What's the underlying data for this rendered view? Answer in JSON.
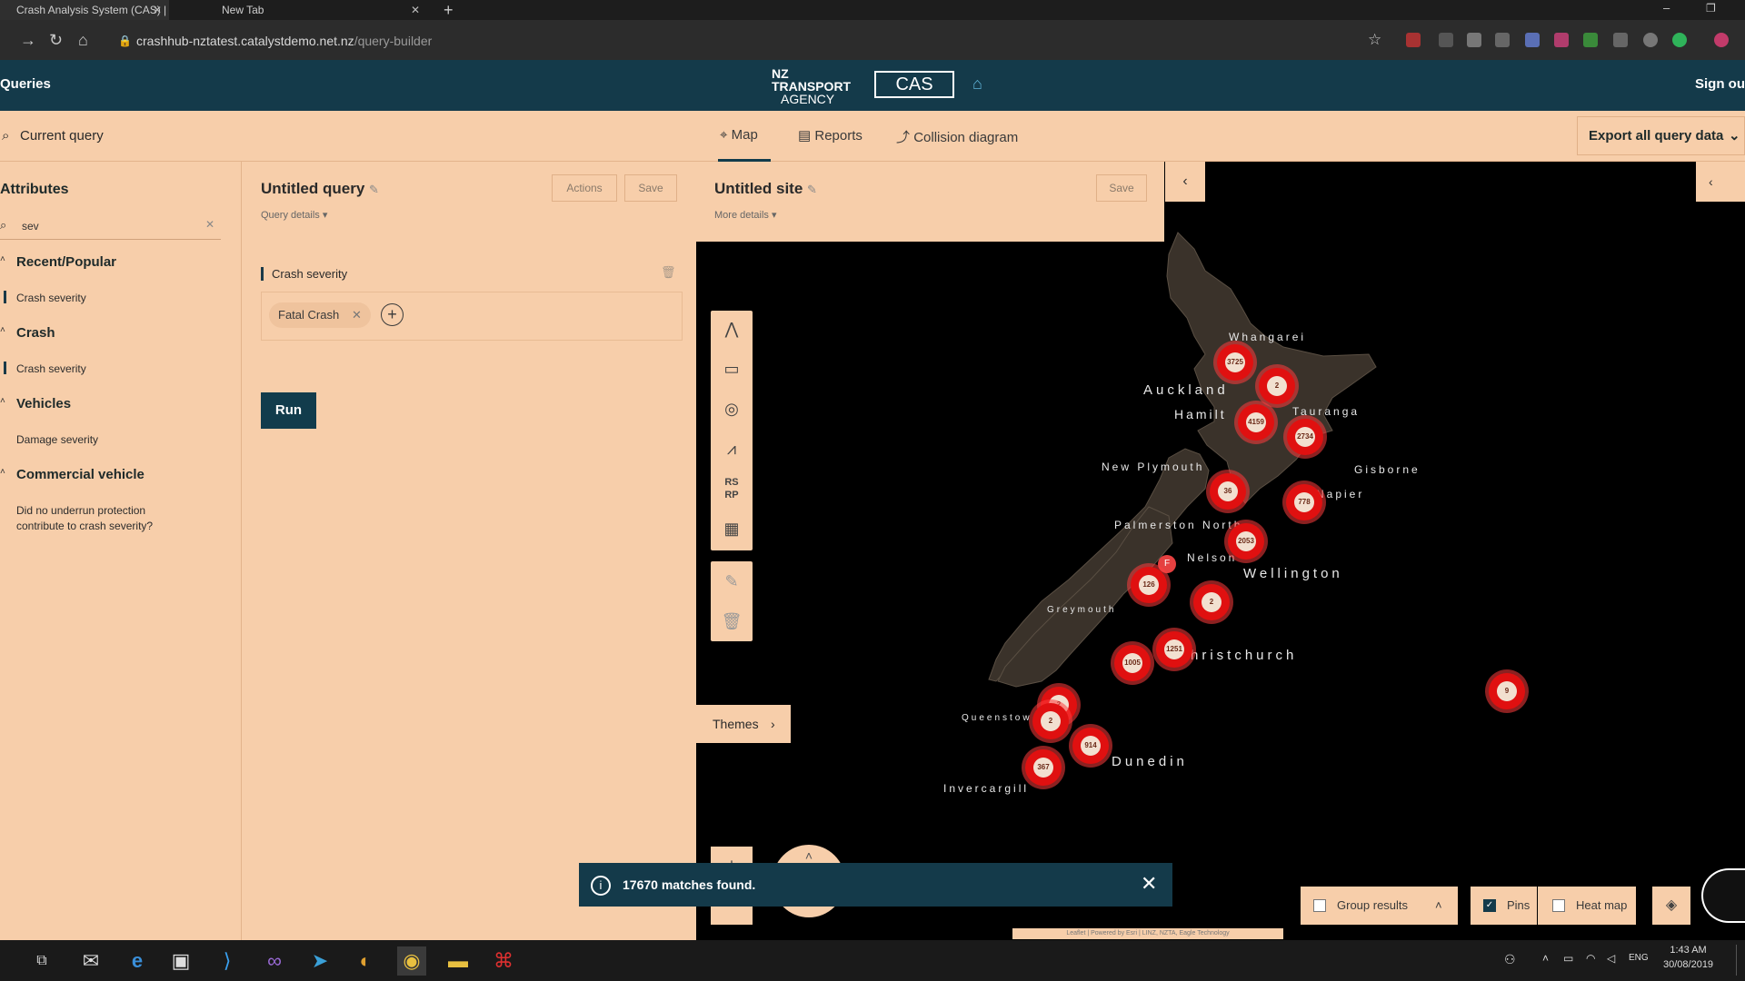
{
  "browser": {
    "tabs": [
      {
        "label": "Crash Analysis System (CAS) | NZ",
        "active": true
      },
      {
        "label": "New Tab",
        "active": false
      }
    ],
    "url_host": "crashhub-nztatest.catalystdemo.net.nz",
    "url_path": "/query-builder"
  },
  "header": {
    "left_title": "Queries",
    "right_link": "Sign ou",
    "logo_line1": "NZ TRANSPORT",
    "logo_line2": "AGENCY",
    "logo_cas": "CAS"
  },
  "left": {
    "current_query_label": "Current query",
    "attributes_title": "Attributes",
    "search_value": "sev",
    "groups": [
      {
        "heading": "Recent/Popular",
        "items": [
          "Crash severity"
        ]
      },
      {
        "heading": "Crash",
        "items": [
          "Crash severity"
        ]
      },
      {
        "heading": "Vehicles",
        "items": [
          "Damage severity"
        ]
      },
      {
        "heading": "Commercial vehicle",
        "items": [
          "Did no underrun protection contribute to crash severity?"
        ]
      }
    ]
  },
  "query": {
    "title": "Untitled query",
    "details_link": "Query details",
    "actions_label": "Actions",
    "save_label": "Save",
    "criterion_title": "Crash severity",
    "chip_label": "Fatal Crash",
    "run_label": "Run"
  },
  "right_tabs": {
    "map": "Map",
    "reports": "Reports",
    "collision": "Collision diagram",
    "export": "Export all query data"
  },
  "site": {
    "title": "Untitled site",
    "details_link": "More details",
    "save_label": "Save"
  },
  "map": {
    "themes_label": "Themes",
    "cities": [
      "Whangarei",
      "Auckland",
      "Hamilt",
      "Tauranga",
      "New Plymouth",
      "Gisborne",
      "Napier",
      "Palmerston North",
      "Nelson",
      "Wellington",
      "Greymouth",
      "hristchurch",
      "Queenstow",
      "Dunedin",
      "Invercargill"
    ],
    "clusters": [
      "3725",
      "2",
      "4159",
      "2734",
      "36",
      "778",
      "2053",
      "126",
      "2",
      "1251",
      "1005",
      "2",
      "2",
      "914",
      "367",
      "9"
    ],
    "attribution": "Leaflet | Powered by Esri | LINZ, NZTA, Eagle Technology"
  },
  "toast": {
    "message": "17670 matches found."
  },
  "map_controls": {
    "group_label": "Group results",
    "pins_label": "Pins",
    "heat_label": "Heat map",
    "pins_checked": true
  },
  "taskbar": {
    "time": "1:43 AM",
    "date": "30/08/2019",
    "lang": "ENG"
  }
}
